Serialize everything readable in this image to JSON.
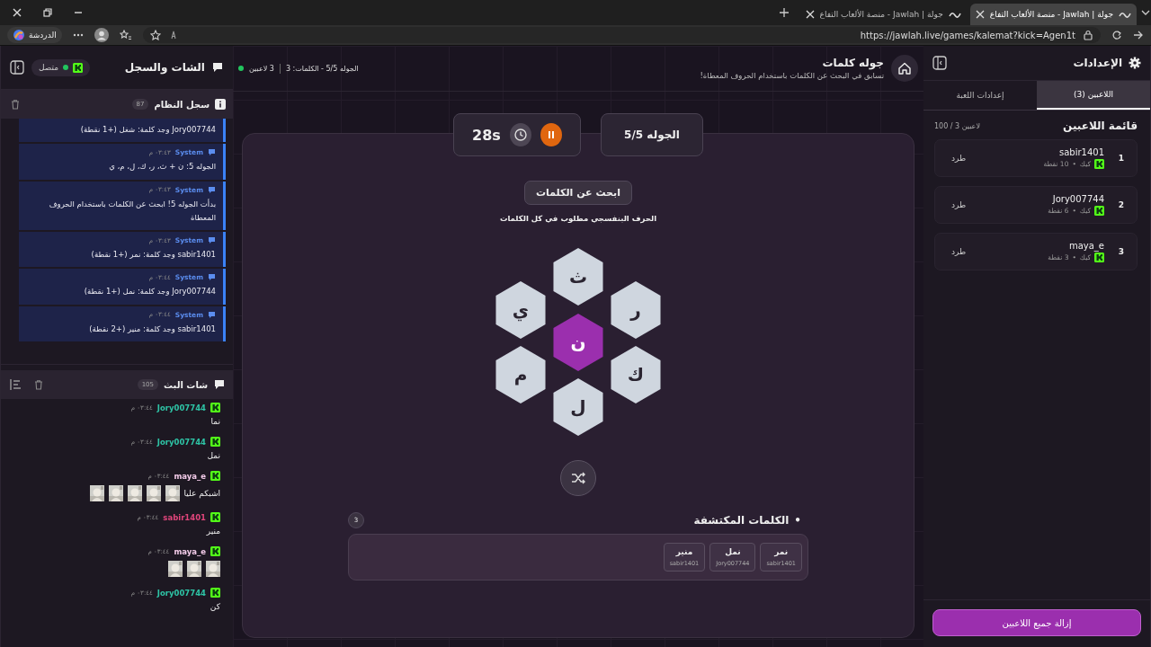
{
  "browser": {
    "tabs": [
      {
        "title": "جولة | Jawlah - منصة الألعاب التفاع",
        "selected": true
      },
      {
        "title": "جولة | Jawlah - منصة الألعاب التفاع",
        "selected": false
      }
    ],
    "copilot_label": "الدردشة",
    "address": "https://jawlah.live/games/kalemat?kick=Agen1t"
  },
  "chat_panel": {
    "title": "الشات والسجل",
    "status": "متصل",
    "log": {
      "title": "سجل النظام",
      "count": "87",
      "entries": [
        {
          "text": "Jory007744 وجد كلمة: شغل (+1 نقطة)"
        },
        {
          "sender": "System",
          "time": "٠٣:٤٣ م",
          "text": "الجوله 5: ن + ث، ر، ك، ل، م، ي"
        },
        {
          "sender": "System",
          "time": "٠٣:٤٣ م",
          "text": "بدأت الجوله 5! ابحث عن الكلمات باستخدام الحروف المعطاة"
        },
        {
          "sender": "System",
          "time": "٠٣:٤٣ م",
          "text": "sabir1401 وجد كلمة: نمر (+1 نقطة)"
        },
        {
          "sender": "System",
          "time": "٠٣:٤٤ م",
          "text": "Jory007744 وجد كلمة: نمل (+1 نقطة)"
        },
        {
          "sender": "System",
          "time": "٠٣:٤٤ م",
          "text": "sabir1401 وجد كلمة: منير (+2 نقطة)"
        }
      ]
    },
    "chat": {
      "title": "شات البث",
      "count": "105",
      "messages": [
        {
          "user": "Jory007744",
          "color": "#2ec4a6",
          "time": "٠٣:٤٤ م",
          "text": "نما"
        },
        {
          "user": "Jory007744",
          "color": "#2ec4a6",
          "time": "٠٣:٤٤ م",
          "text": "نمل"
        },
        {
          "user": "maya_e",
          "color": "#f3cbe9",
          "time": "٠٣:٤٤ م",
          "text": "اشبكم عليا"
        },
        {
          "user": "sabir1401",
          "color": "#e0457b",
          "time": "٠٣:٤٤ م",
          "text": "منير"
        },
        {
          "user": "maya_e",
          "color": "#f3cbe9",
          "time": "٠٣:٤٤ م"
        },
        {
          "user": "Jory007744",
          "color": "#2ec4a6",
          "time": "٠٣:٤٤ م",
          "text": "كن"
        }
      ]
    }
  },
  "game": {
    "title": "جوله كلمات",
    "subtitle": "تسابق في البحث عن الكلمات باستخدام الحروف المعطاة!",
    "players_online": "3 لاعبين",
    "round_info": "الجوله 5/5 - الكلمات: 3",
    "round": "الجوله 5/5",
    "timer": "28s",
    "prompt": "ابحث عن الكلمات",
    "hint": "الحرف البنفسجي مطلوب في كل الكلمات",
    "letters": [
      {
        "letter": "ث",
        "required": false
      },
      {
        "letter": "ر",
        "required": false
      },
      {
        "letter": "ي",
        "required": false
      },
      {
        "letter": "ن",
        "required": true
      },
      {
        "letter": "ك",
        "required": false
      },
      {
        "letter": "م",
        "required": false
      },
      {
        "letter": "ل",
        "required": false
      }
    ],
    "found": {
      "bullet": "•",
      "title": "الكلمات المكتشفة",
      "count": "3",
      "words": [
        {
          "word": "نمر",
          "player": "sabir1401"
        },
        {
          "word": "نمل",
          "player": "Jory007744"
        },
        {
          "word": "منير",
          "player": "sabir1401"
        }
      ]
    }
  },
  "settings": {
    "title": "الإعدادات",
    "tabs": [
      {
        "label": "اللاعبين (3)",
        "selected": true
      },
      {
        "label": "إعدادات اللعبة",
        "selected": false
      }
    ],
    "list_title": "قائمة اللاعبين",
    "capacity": "100 / 3 لاعبين",
    "players": [
      {
        "rank": "1",
        "name": "sabir1401",
        "platform": "كيك",
        "separator": "•",
        "points": "10 نقطة",
        "action": "طرد"
      },
      {
        "rank": "2",
        "name": "Jory007744",
        "platform": "كيك",
        "separator": "•",
        "points": "6 نقطة",
        "action": "طرد"
      },
      {
        "rank": "3",
        "name": "maya_e",
        "platform": "كيك",
        "separator": "•",
        "points": "3 نقطة",
        "action": "طرد"
      }
    ],
    "clear_button": "إزالة جميع اللاعبين"
  }
}
